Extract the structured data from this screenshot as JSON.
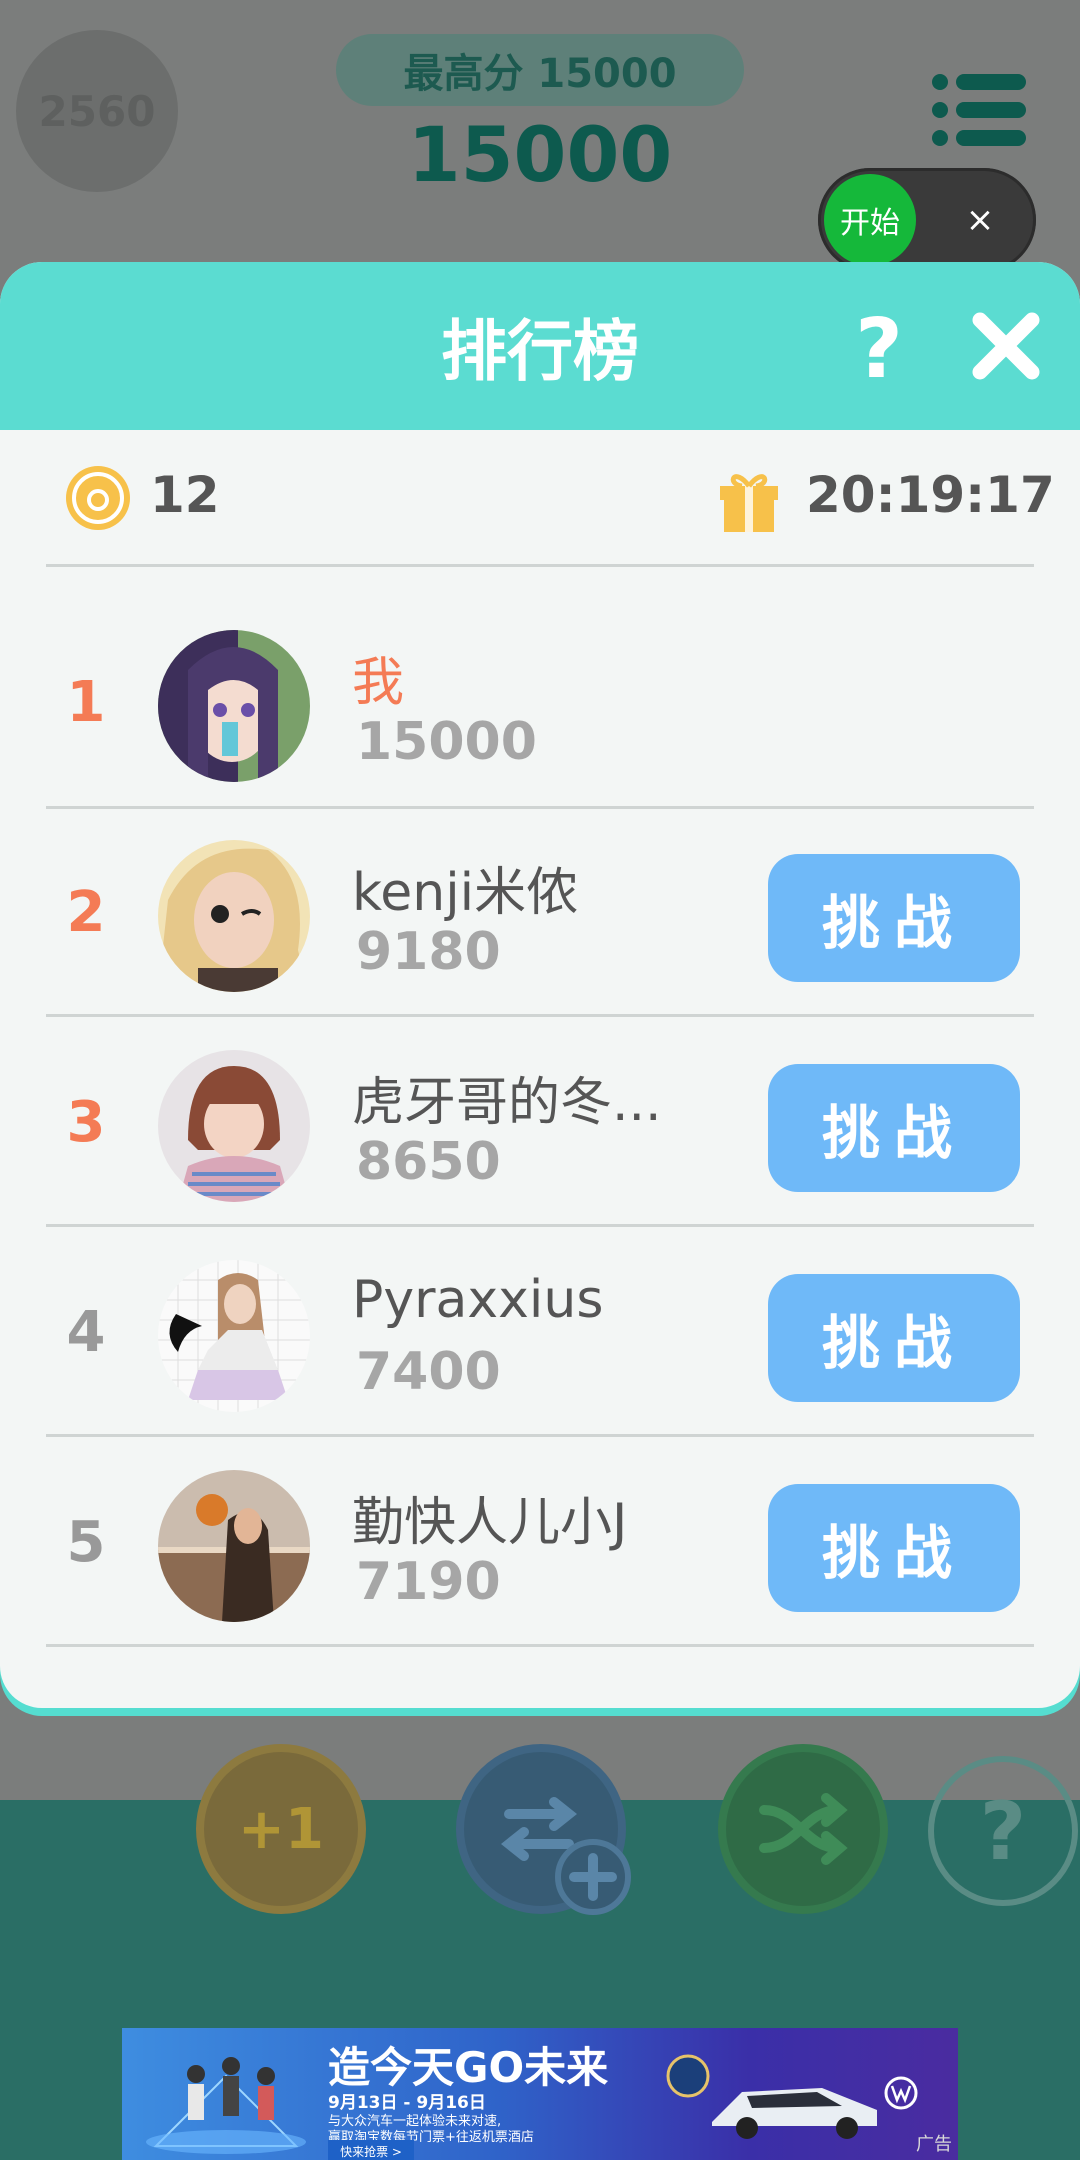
{
  "game": {
    "level_number": "2560",
    "best_score": "最高分 15000",
    "current_score": "15000",
    "start_label": "开始",
    "close_symbol": "×",
    "accent": "#5bdcd1"
  },
  "powerups": {
    "add_one_label": "+1",
    "help_label": "?"
  },
  "leaderboard": {
    "title": "排行榜",
    "help_label": "?",
    "coins": "12",
    "timer": "20:19:17",
    "challenge_label": "挑战",
    "players": [
      {
        "rank": "1",
        "name": "我",
        "score": "15000",
        "is_me": true,
        "avatar": "avatar-anime"
      },
      {
        "rank": "2",
        "name": "kenji米侬",
        "score": "9180",
        "is_me": false,
        "avatar": "avatar-blonde"
      },
      {
        "rank": "3",
        "name": "虎牙哥的冬...",
        "score": "8650",
        "is_me": false,
        "avatar": "avatar-bangs"
      },
      {
        "rank": "4",
        "name": "Pyraxxius",
        "score": "7400",
        "is_me": false,
        "avatar": "avatar-grid"
      },
      {
        "rank": "5",
        "name": "勤快人儿小J",
        "score": "7190",
        "is_me": false,
        "avatar": "avatar-beach"
      }
    ]
  },
  "ad": {
    "title": "造今天GO未来",
    "line1": "9月13日 - 9月16日",
    "line2": "与大众汽车一起体验未来对速,",
    "line3": "赢取淘宝数每节门票+往返机票酒店",
    "cta": "快来抢票 >",
    "tag": "广告"
  }
}
